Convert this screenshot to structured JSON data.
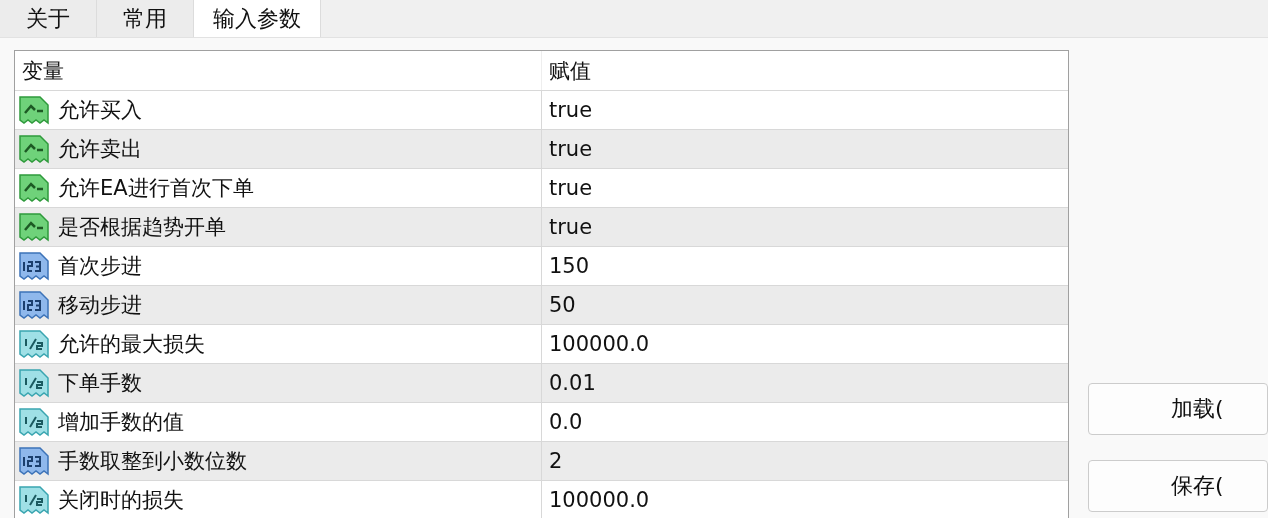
{
  "tabs": [
    {
      "label": "关于",
      "selected": false
    },
    {
      "label": "常用",
      "selected": false
    },
    {
      "label": "输入参数",
      "selected": true
    }
  ],
  "table": {
    "columns": [
      "变量",
      "赋值"
    ],
    "rows": [
      {
        "kind": "bool",
        "name": "允许买入",
        "value": "true",
        "selected": false
      },
      {
        "kind": "bool",
        "name": "允许卖出",
        "value": "true",
        "selected": false
      },
      {
        "kind": "bool",
        "name": "允许EA进行首次下单",
        "value": "true",
        "selected": false
      },
      {
        "kind": "bool",
        "name": "是否根据趋势开单",
        "value": "true",
        "selected": false
      },
      {
        "kind": "int",
        "name": "首次步进",
        "value": "150",
        "selected": false
      },
      {
        "kind": "int",
        "name": "移动步进",
        "value": "50",
        "selected": false
      },
      {
        "kind": "double",
        "name": "允许的最大损失",
        "value": "100000.0",
        "selected": false
      },
      {
        "kind": "double",
        "name": "下单手数",
        "value": "0.01",
        "selected": false
      },
      {
        "kind": "double",
        "name": "增加手数的值",
        "value": "0.0",
        "selected": false
      },
      {
        "kind": "int",
        "name": "手数取整到小数位数",
        "value": "2",
        "selected": false
      },
      {
        "kind": "double",
        "name": "关闭时的损失",
        "value": "100000.0",
        "selected": false
      }
    ]
  },
  "buttons": [
    "加载(",
    "保存("
  ]
}
